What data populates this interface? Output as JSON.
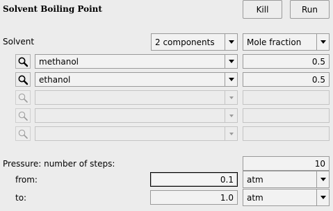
{
  "header": {
    "title": "Solvent Boiling Point",
    "kill_label": "Kill",
    "run_label": "Run"
  },
  "solvent": {
    "label": "Solvent",
    "components_selected": "2 components",
    "units_selected": "Mole fraction",
    "rows": [
      {
        "name": "methanol",
        "value": "0.5",
        "enabled": true
      },
      {
        "name": "ethanol",
        "value": "0.5",
        "enabled": true
      },
      {
        "name": "",
        "value": "",
        "enabled": false
      },
      {
        "name": "",
        "value": "",
        "enabled": false
      },
      {
        "name": "",
        "value": "",
        "enabled": false
      }
    ]
  },
  "pressure": {
    "steps_label": "Pressure: number of steps:",
    "steps_value": "10",
    "from_label": "from:",
    "from_value": "0.1",
    "from_unit": "atm",
    "to_label": "to:",
    "to_value": "1.0",
    "to_unit": "atm"
  }
}
